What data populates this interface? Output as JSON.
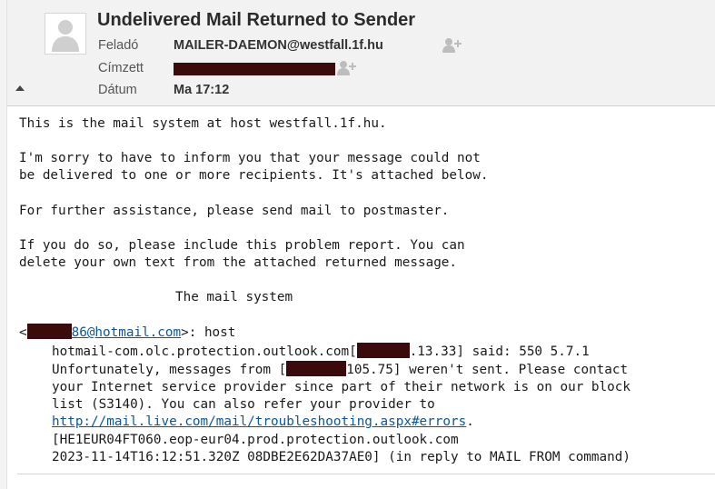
{
  "header": {
    "subject": "Undelivered Mail Returned to Sender",
    "from_label": "Feladó",
    "from_value": "MAILER-DAEMON@westfall.1f.hu",
    "to_label": "Címzett",
    "date_label": "Dátum",
    "date_value": "Ma 17:12"
  },
  "icons": {
    "avatar": "avatar-placeholder-icon",
    "add_contact": "add-contact-icon",
    "collapse": "collapse-arrow-icon"
  },
  "body": {
    "line1": "This is the mail system at host westfall.1f.hu.",
    "line2": "I'm sorry to have to inform you that your message could not",
    "line3": "be delivered to one or more recipients. It's attached below.",
    "line4": "For further assistance, please send mail to postmaster.",
    "line5": "If you do so, please include this problem report. You can",
    "line6": "delete your own text from the attached returned message.",
    "signature": "The mail system",
    "recipient_open": "<",
    "recipient_email_visible": "86@hotmail.com",
    "recipient_close": ">: host",
    "host_prefix": "hotmail-com.olc.protection.outlook.com[",
    "host_suffix": ".13.33] said: 550 5.7.1",
    "unfortunately_prefix": "Unfortunately, messages from [",
    "unfortunately_suffix": "105.75] weren't sent. Please contact",
    "provider_line": "your Internet service provider since part of their network is on our block",
    "list_line": "list (S3140). You can also refer your provider to",
    "help_link": "http://mail.live.com/mail/troubleshooting.aspx#errors",
    "link_after": ".",
    "server_line": "[HE1EUR04FT060.eop-eur04.prod.protection.outlook.com",
    "timestamp_line": "2023-11-14T16:12:51.320Z 08DBE2E62DA37AE0] (in reply to MAIL FROM command)"
  }
}
